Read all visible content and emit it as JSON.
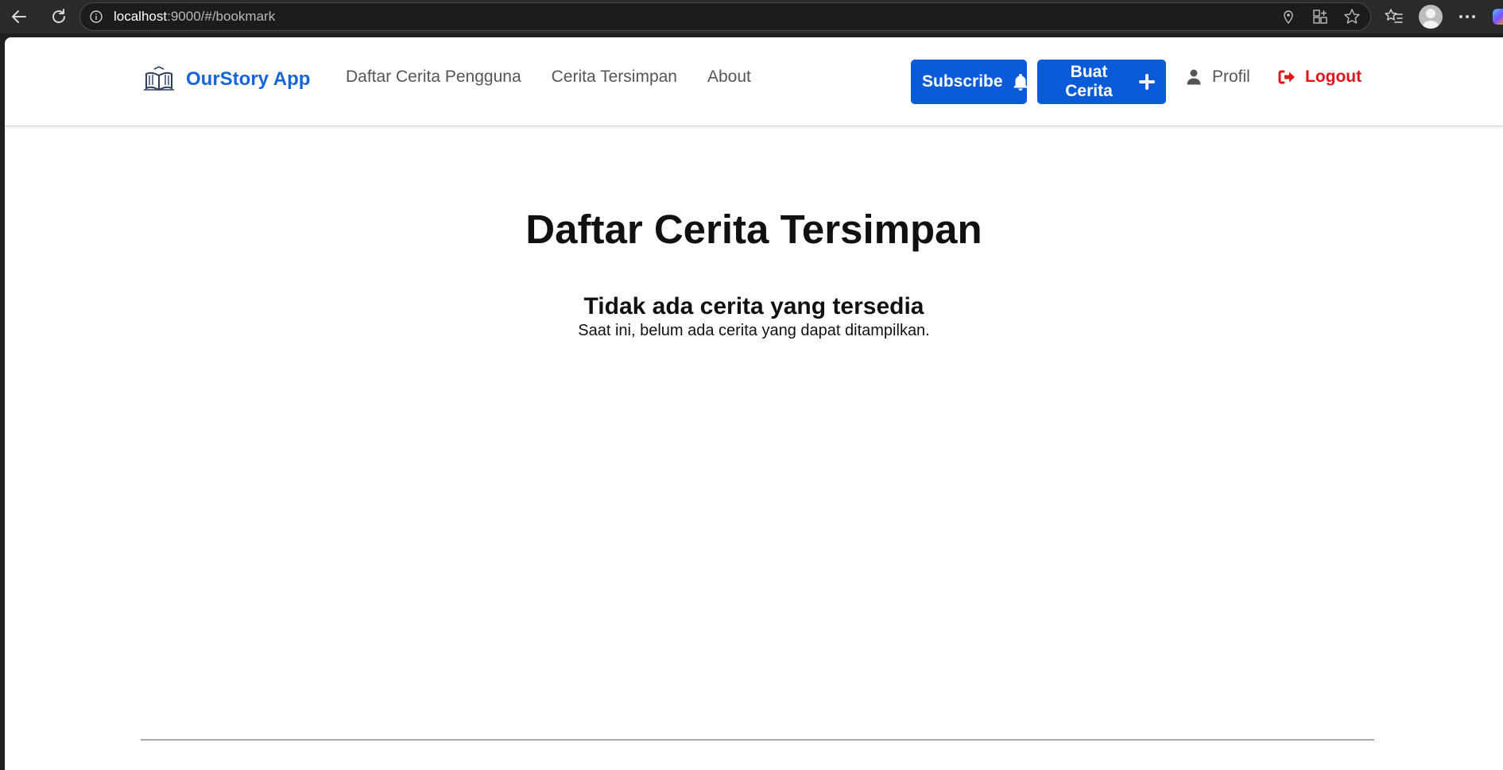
{
  "browser": {
    "url_host": "localhost",
    "url_path": ":9000/#/bookmark",
    "icons": [
      "back-icon",
      "reload-icon",
      "info-icon",
      "location-icon",
      "extensions-icon",
      "favorite-star-icon",
      "favorites-list-icon",
      "profile-avatar-icon",
      "more-menu-icon"
    ]
  },
  "navbar": {
    "brand_name": "OurStory App",
    "links": [
      "Daftar Cerita Pengguna",
      "Cerita Tersimpan",
      "About"
    ],
    "subscribe_label": "Subscribe",
    "create_label": "Buat Cerita",
    "profile_label": "Profil",
    "logout_label": "Logout"
  },
  "main": {
    "title": "Daftar Cerita Tersimpan",
    "empty_title": "Tidak ada cerita yang tersedia",
    "empty_desc": "Saat ini, belum ada cerita yang dapat ditampilkan."
  },
  "colors": {
    "brand": "#1565d8",
    "primary_button": "#0a5bd8",
    "logout": "#e0151c"
  }
}
